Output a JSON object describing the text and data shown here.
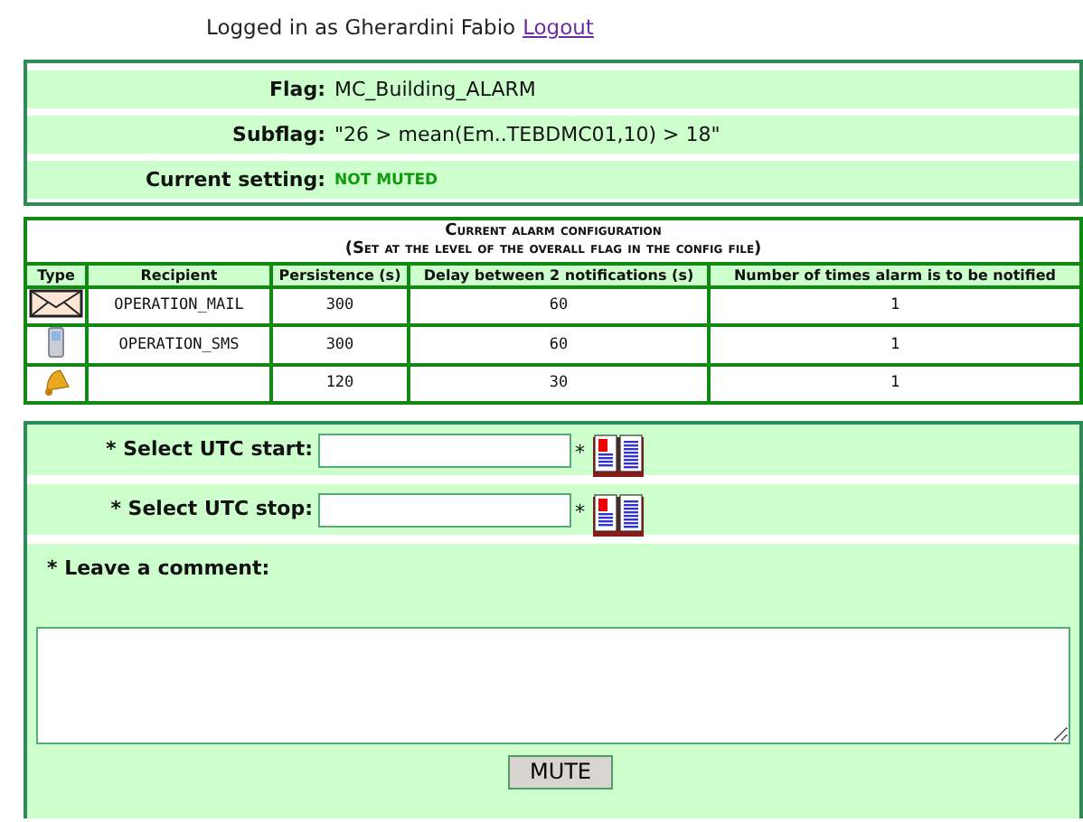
{
  "login": {
    "text": "Logged in as Gherardini Fabio",
    "link": "Logout"
  },
  "flag_info": [
    {
      "label": "Flag:",
      "value": "MC_Building_ALARM",
      "kind": "plain"
    },
    {
      "label": "Subflag:",
      "value": "\"26 > mean(Em..TEBDMC01,10) > 18\"",
      "kind": "plain"
    },
    {
      "label": "Current setting:",
      "value": "NOT MUTED",
      "kind": "status"
    }
  ],
  "alarm_table": {
    "title": "Current alarm configuration",
    "subtitle": "(Set at the level of the overall flag in the config file)",
    "columns": [
      "Type",
      "Recipient",
      "Persistence (s)",
      "Delay between 2 notifications (s)",
      "Number of times alarm is to be notified"
    ],
    "rows": [
      {
        "kind": "mail",
        "recipient": "OPERATION_MAIL",
        "persistence": "300",
        "delay": "60",
        "times": "1"
      },
      {
        "kind": "sms",
        "recipient": "OPERATION_SMS",
        "persistence": "300",
        "delay": "60",
        "times": "1"
      },
      {
        "kind": "bell",
        "persistence": "120",
        "delay": "30",
        "times": "1"
      }
    ]
  },
  "form": {
    "fields": [
      {
        "label": "* Select UTC start:",
        "required_mark": "*"
      },
      {
        "label": "* Select UTC stop:",
        "required_mark": "*"
      }
    ],
    "comment_label": "* Leave a comment:",
    "button": "MUTE"
  }
}
